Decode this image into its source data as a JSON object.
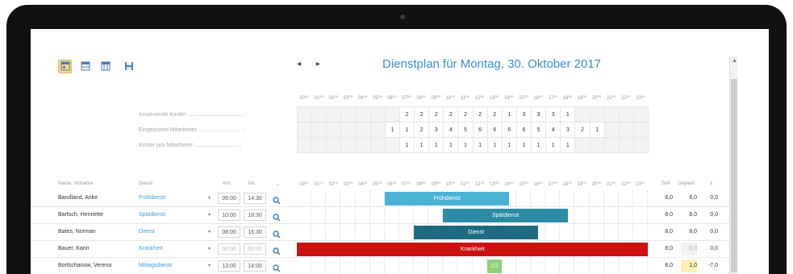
{
  "toolbar": {
    "icons": [
      "view-day-icon",
      "view-week-icon",
      "view-month-icon",
      "save-icon"
    ]
  },
  "nav": {
    "arrows": "◂ ▸"
  },
  "title": "Dienstplan für Montag, 30. Oktober 2017",
  "hours": [
    "00⁰⁰",
    "01⁰⁰",
    "02⁰⁰",
    "03⁰⁰",
    "04⁰⁰",
    "05⁰⁰",
    "06⁰⁰",
    "07⁰⁰",
    "08⁰⁰",
    "09⁰⁰",
    "10⁰⁰",
    "11⁰⁰",
    "12⁰⁰",
    "13⁰⁰",
    "14⁰⁰",
    "15⁰⁰",
    "16⁰⁰",
    "17⁰⁰",
    "18⁰⁰",
    "19⁰⁰",
    "20⁰⁰",
    "21⁰⁰",
    "22⁰⁰",
    "23⁰⁰"
  ],
  "stats": [
    {
      "label": "Anwesende Kinder ................................... :",
      "values": [
        "",
        "",
        "",
        "",
        "",
        "",
        "",
        "2",
        "2",
        "2",
        "2",
        "2",
        "2",
        "2",
        "1",
        "3",
        "3",
        "3",
        "1",
        "",
        "",
        "",
        "",
        ""
      ]
    },
    {
      "label": "Eingeplante Mitarbeiter ........................... :",
      "values": [
        "",
        "",
        "",
        "",
        "",
        "",
        "1",
        "1",
        "2",
        "3",
        "4",
        "5",
        "6",
        "6",
        "6",
        "6",
        "5",
        "4",
        "3",
        "2",
        "1",
        "",
        "",
        ""
      ]
    },
    {
      "label": "Kinder pro Mitarbeiter ............................ :",
      "values": [
        "",
        "",
        "",
        "",
        "",
        "",
        "",
        "1",
        "1",
        "1",
        "1",
        "1",
        "1",
        "1",
        "1",
        "1",
        "1",
        "1",
        "1",
        "",
        "",
        "",
        "",
        ""
      ]
    }
  ],
  "columns": {
    "name": "Name, Vorname",
    "dienst": "Dienst",
    "von": "von",
    "bis": "bis",
    "soll": "Soll",
    "geplant": "Geplant",
    "diff": "±"
  },
  "employees": [
    {
      "name": "Bandland, Anke",
      "dienst": "Frühdienst",
      "von": "06:00",
      "bis": "14:30",
      "bar": {
        "label": "Frühdienst",
        "color": "#4bb2d3"
      },
      "soll": "8,0",
      "geplant": "8,0",
      "diff": "0,0"
    },
    {
      "name": "Bartsch, Henriette",
      "dienst": "Spätdienst",
      "von": "10:00",
      "bis": "18:30",
      "bar": {
        "label": "Spätdienst",
        "color": "#2e8ba6"
      },
      "soll": "8,0",
      "geplant": "8,0",
      "diff": "0,0"
    },
    {
      "name": "Bates, Norman",
      "dienst": "Dienst",
      "von": "08:00",
      "bis": "16:30",
      "bar": {
        "label": "Dienst",
        "color": "#1f6a80"
      },
      "soll": "8,0",
      "geplant": "8,0",
      "diff": "0,0"
    },
    {
      "name": "Bauer, Karin",
      "dienst": "Krankheit",
      "von": "00:00",
      "bis": "00:00",
      "bar": {
        "label": "Krankheit",
        "color": "#cc1111"
      },
      "soll": "8,0",
      "geplant": "0,0",
      "diff": "0,0"
    },
    {
      "name": "Bortschanow, Verena",
      "dienst": "Mittagsdienst",
      "von": "13:00",
      "bis": "14:00",
      "bar": {
        "label": "1/2",
        "color": "#8fd07a"
      },
      "soll": "8,0",
      "geplant": "1,0",
      "diff": "-7,0"
    }
  ]
}
